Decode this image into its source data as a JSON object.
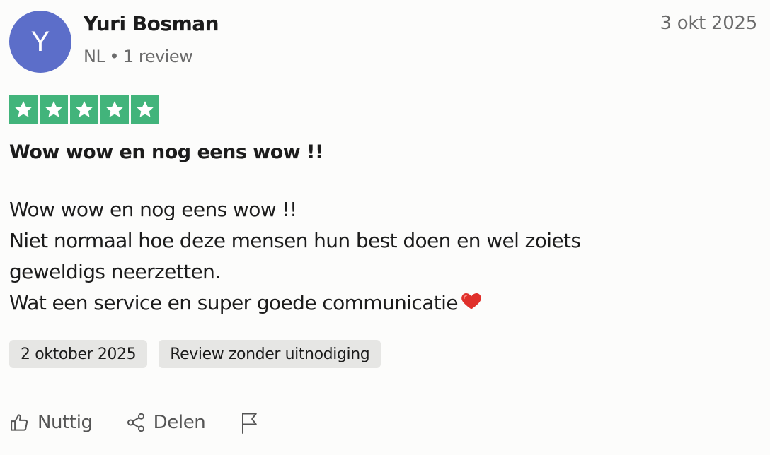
{
  "review": {
    "avatar_initial": "Y",
    "reviewer_name": "Yuri Bosman",
    "country": "NL",
    "review_count": "1 review",
    "date_short": "3 okt 2025",
    "rating": 5,
    "rating_max": 5,
    "title": "Wow wow en nog eens wow !!",
    "body_lines": [
      "Wow wow en nog eens wow !!",
      "Niet normaal hoe deze mensen hun best doen en wel zoiets",
      "geweldigs neerzetten.",
      "Wat een service en super goede communicatie"
    ],
    "tags": [
      "2 oktober 2025",
      "Review zonder uitnodiging"
    ]
  },
  "actions": {
    "useful_label": "Nuttig",
    "share_label": "Delen"
  },
  "colors": {
    "avatar_bg": "#5c6ec9",
    "star_green": "#42b47b",
    "tag_bg": "#e6e6e4",
    "heart": "#e0302b"
  },
  "icons": {
    "useful": "thumbs-up-icon",
    "share": "share-icon",
    "report": "flag-icon",
    "heart": "heart-emoji"
  }
}
